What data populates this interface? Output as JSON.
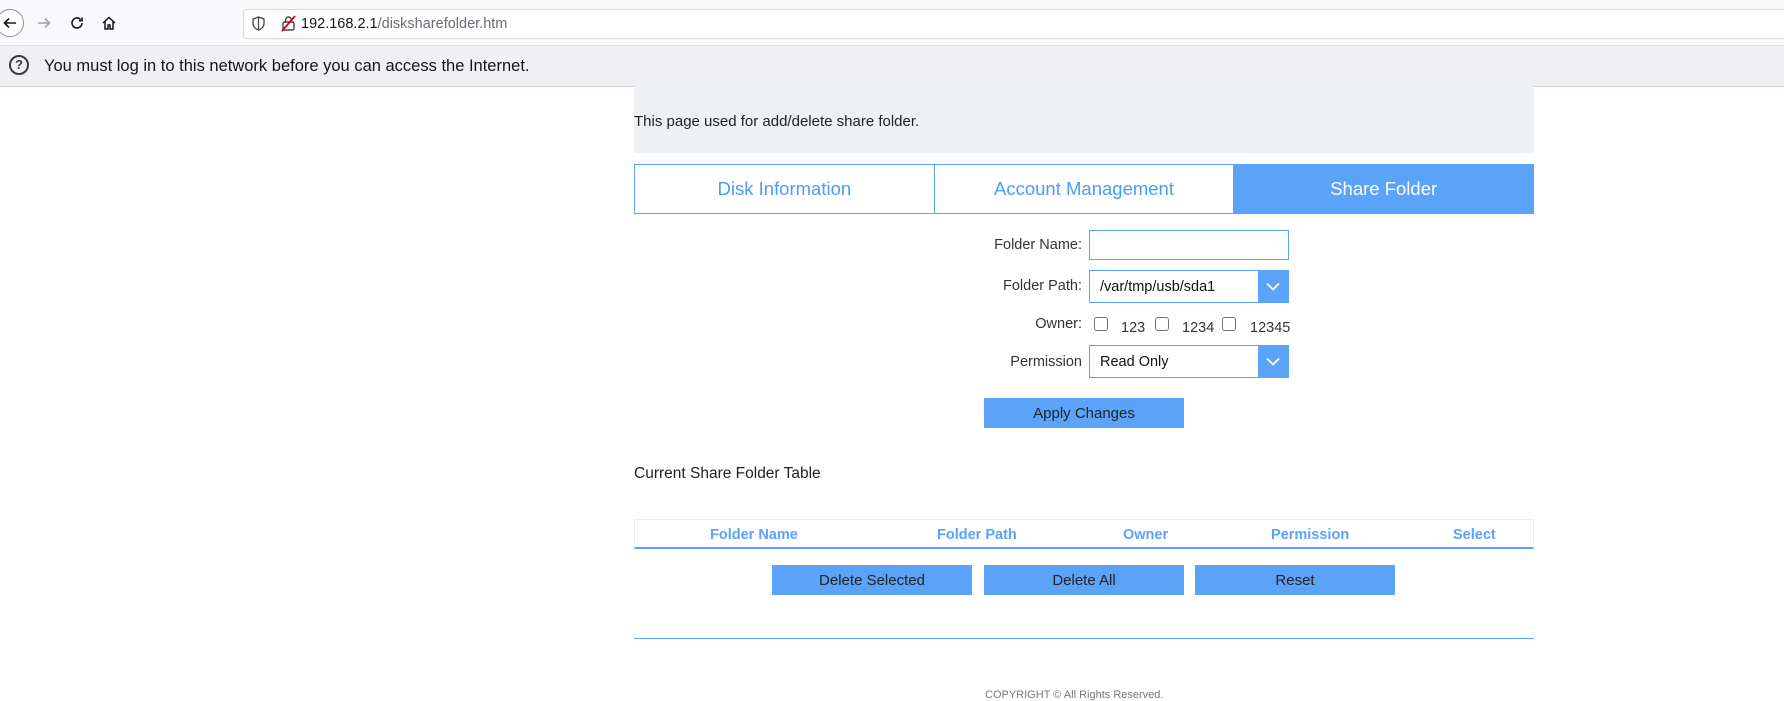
{
  "browser": {
    "url_host": "192.168.2.1",
    "url_path": "/disksharefolder.htm",
    "notice": "You must log in to this network before you can access the Internet."
  },
  "page": {
    "description": "This page used for add/delete share folder.",
    "tabs": [
      {
        "label": "Disk Information",
        "active": false
      },
      {
        "label": "Account Management",
        "active": false
      },
      {
        "label": "Share Folder",
        "active": true
      }
    ],
    "form": {
      "folder_name_label": "Folder Name:",
      "folder_name_value": "",
      "folder_path_label": "Folder Path:",
      "folder_path_value": "/var/tmp/usb/sda1",
      "owner_label": "Owner:",
      "owners": [
        "123",
        "1234",
        "12345"
      ],
      "permission_label": "Permission",
      "permission_value": "Read Only",
      "apply_label": "Apply Changes"
    },
    "table": {
      "title": "Current Share Folder Table",
      "columns": [
        "Folder Name",
        "Folder Path",
        "Owner",
        "Permission",
        "Select"
      ],
      "rows": []
    },
    "actions": {
      "delete_selected": "Delete Selected",
      "delete_all": "Delete All",
      "reset": "Reset"
    },
    "footer": "COPYRIGHT © All Rights Reserved."
  },
  "colors": {
    "accent": "#5aa3f8",
    "description_bg": "#eef1f4"
  }
}
